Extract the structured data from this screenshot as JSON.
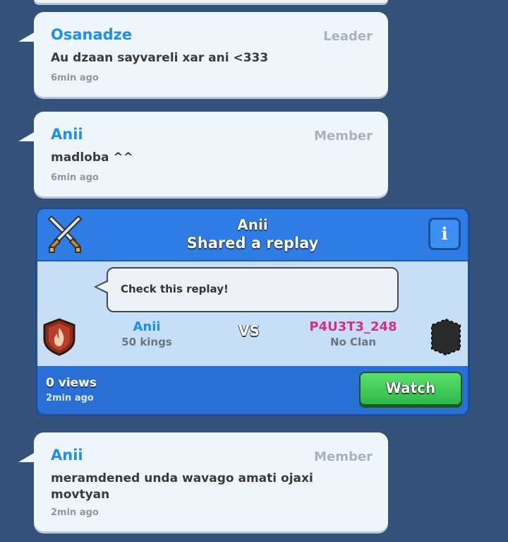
{
  "messages": [
    {
      "name": "Osanadze",
      "role": "Leader",
      "text": "Au dzaan sayvareli xar ani <333",
      "time": "6min ago"
    },
    {
      "name": "Anii",
      "role": "Member",
      "text": "madloba ^^",
      "time": "6min ago"
    },
    {
      "name": "Anii",
      "role": "Member",
      "text": "meramdened unda wavago amati ojaxi movtyan",
      "time": "2min ago"
    }
  ],
  "replay": {
    "user": "Anii",
    "action": "Shared a replay",
    "info_label": "i",
    "comment": "Check this replay!",
    "player1": {
      "name": "Anii",
      "clan": "50 kings"
    },
    "vs_label": "VS",
    "player2": {
      "name": "P4U3T3_248",
      "clan": "No Clan"
    },
    "views": "0 views",
    "time": "2min ago",
    "watch_label": "Watch"
  },
  "colors": {
    "background": "#35527a",
    "name_blue": "#1f8ef1",
    "opponent_pink": "#d62d86",
    "watch_green": "#3fcc57"
  },
  "icons": [
    "crossed-swords-icon",
    "info-icon",
    "clan-badge-fire-icon",
    "empty-clan-badge-icon"
  ]
}
